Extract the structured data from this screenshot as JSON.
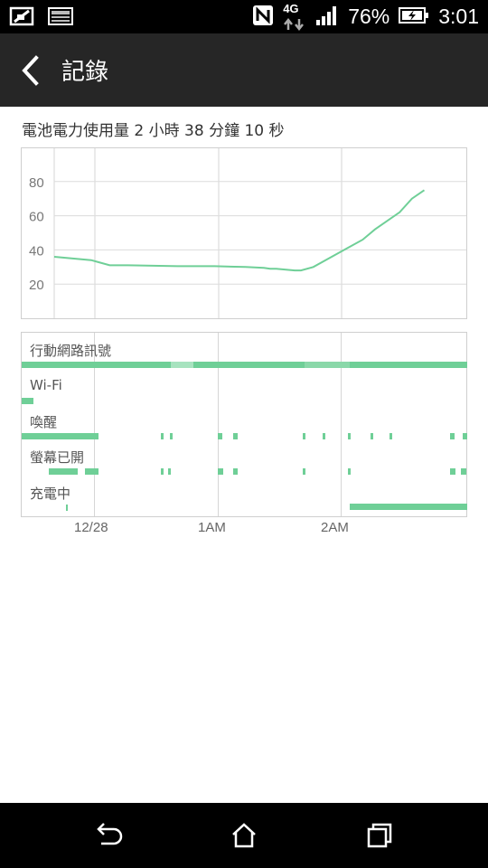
{
  "status_bar": {
    "battery_percent": "76%",
    "time": "3:01",
    "network_label": "4G",
    "icons": [
      "screen-cast-icon",
      "notification-card-icon",
      "nfc-icon",
      "data-arrows-icon",
      "signal-strength-icon",
      "battery-charging-icon"
    ]
  },
  "header": {
    "title": "記錄",
    "back_icon": "chevron-left-icon"
  },
  "summary": "電池電力使用量 2 小時 38 分鐘 10 秒",
  "chart_data": {
    "type": "line",
    "title": "",
    "xlabel": "",
    "ylabel": "",
    "yticks": [
      "20",
      "40",
      "60",
      "80"
    ],
    "ylim": [
      0,
      100
    ],
    "xticks": [
      "12/28",
      "1AM",
      "2AM"
    ],
    "x_hours": [
      0.0,
      0.3,
      0.35,
      0.45,
      0.6,
      1.0,
      1.3,
      1.55,
      1.7,
      1.75,
      1.8,
      1.95,
      2.0,
      2.1,
      2.2,
      2.35,
      2.5,
      2.6,
      2.8,
      2.9,
      3.0
    ],
    "series": [
      {
        "values": [
          36,
          34,
          33,
          31,
          31,
          30.5,
          30.5,
          30,
          29.5,
          29,
          29,
          28,
          28,
          30,
          34,
          40,
          46,
          52,
          62,
          70,
          75
        ]
      }
    ],
    "line_color": "#6fcf97",
    "grid": true
  },
  "activity": {
    "rows": [
      {
        "label": "行動網路訊號"
      },
      {
        "label": "Wi-Fi"
      },
      {
        "label": "喚醒"
      },
      {
        "label": "螢幕已開"
      },
      {
        "label": "充電中"
      }
    ],
    "bar_color": "#6fcf97"
  },
  "navbar": {
    "back_icon": "back-arrow-icon",
    "home_icon": "home-icon",
    "recents_icon": "recents-icon"
  }
}
